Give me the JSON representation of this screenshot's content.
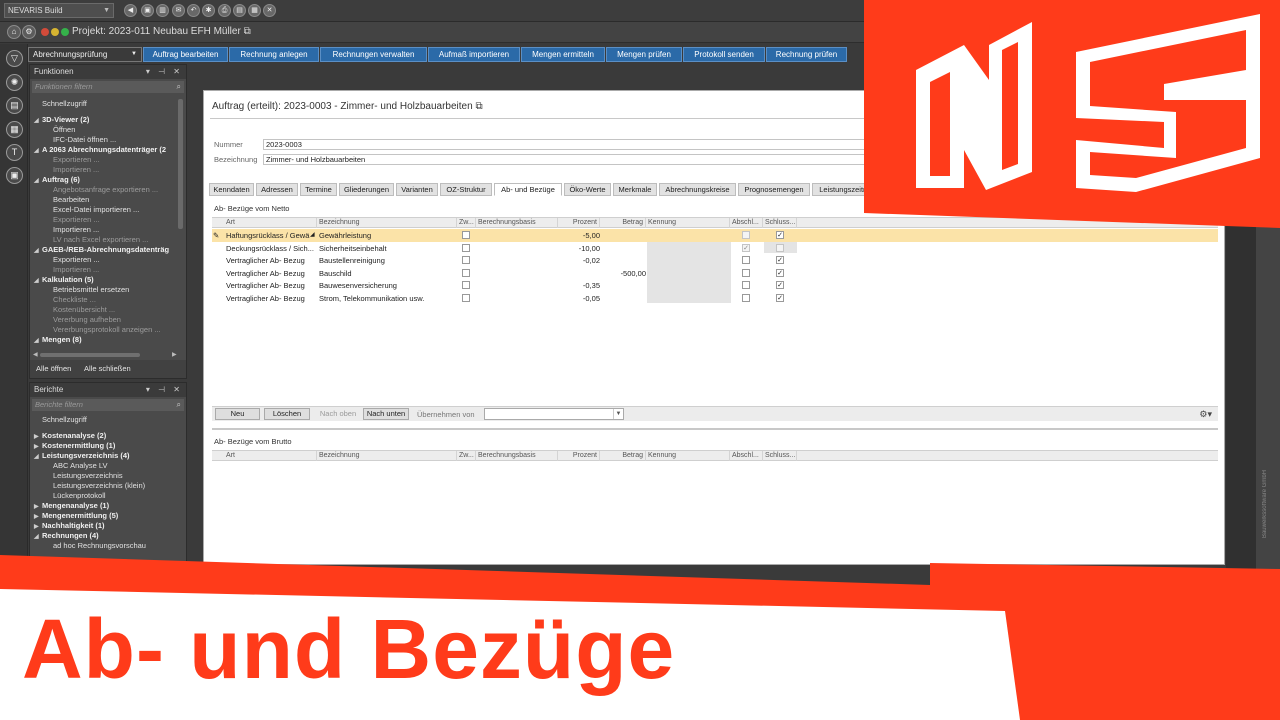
{
  "titlebar": {
    "app_selector": "NEVARIS Build",
    "icons": [
      "back-icon",
      "save-icon",
      "delete-icon",
      "mail-icon",
      "undo-icon",
      "settings-icon",
      "print-icon",
      "close-icon"
    ]
  },
  "projectbar": {
    "title": "Projekt: 2023-011 Neubau EFH Müller ⧉"
  },
  "ribbon": {
    "mode": "Abrechnungsprüfung",
    "tabs": [
      "Auftrag bearbeiten",
      "Rechnung anlegen",
      "Rechnungen verwalten",
      "Aufmaß importieren",
      "Mengen ermitteln",
      "Mengen prüfen",
      "Protokoll senden",
      "Rechnung prüfen"
    ]
  },
  "functions_panel": {
    "title": "Funktionen",
    "controls": "▾ ⊣ ✕",
    "filter_placeholder": "Funktionen filtern",
    "quick_access": "Schnellzugriff",
    "tree": [
      {
        "text": "3D-Viewer (2)",
        "kind": "group"
      },
      {
        "text": "Öffnen",
        "kind": "item"
      },
      {
        "text": "IFC-Datei öffnen ...",
        "kind": "item"
      },
      {
        "text": "A 2063 Abrechnungsdatenträger (2",
        "kind": "group"
      },
      {
        "text": "Exportieren ...",
        "kind": "dim"
      },
      {
        "text": "Importieren ...",
        "kind": "dim"
      },
      {
        "text": "Auftrag (6)",
        "kind": "group"
      },
      {
        "text": "Angebotsanfrage exportieren ...",
        "kind": "dim"
      },
      {
        "text": "Bearbeiten",
        "kind": "item"
      },
      {
        "text": "Excel-Datei importieren ...",
        "kind": "item"
      },
      {
        "text": "Exportieren ...",
        "kind": "dim"
      },
      {
        "text": "Importieren ...",
        "kind": "item"
      },
      {
        "text": "LV nach Excel exportieren ...",
        "kind": "dim"
      },
      {
        "text": "GAEB-/REB-Abrechnungsdatenträg",
        "kind": "group"
      },
      {
        "text": "Exportieren ...",
        "kind": "item"
      },
      {
        "text": "Importieren ...",
        "kind": "dim"
      },
      {
        "text": "Kalkulation (5)",
        "kind": "group"
      },
      {
        "text": "Betriebsmittel ersetzen",
        "kind": "item"
      },
      {
        "text": "Checkliste ...",
        "kind": "dim"
      },
      {
        "text": "Kostenübersicht ...",
        "kind": "dim"
      },
      {
        "text": "Vererbung aufheben",
        "kind": "dim"
      },
      {
        "text": "Vererbungsprotokoll anzeigen ...",
        "kind": "dim"
      },
      {
        "text": "Mengen (8)",
        "kind": "group"
      }
    ],
    "open_all": "Alle öffnen",
    "close_all": "Alle schließen"
  },
  "reports_panel": {
    "title": "Berichte",
    "controls": "▾ ⊣ ✕",
    "filter_placeholder": "Berichte filtern",
    "quick_access": "Schnellzugriff",
    "tree": [
      {
        "text": "Kostenanalyse (2)",
        "kind": "group",
        "open": false
      },
      {
        "text": "Kostenermittlung (1)",
        "kind": "group",
        "open": false
      },
      {
        "text": "Leistungsverzeichnis (4)",
        "kind": "group",
        "open": true
      },
      {
        "text": "ABC Analyse LV",
        "kind": "item"
      },
      {
        "text": "Leistungsverzeichnis",
        "kind": "item"
      },
      {
        "text": "Leistungsverzeichnis (klein)",
        "kind": "item"
      },
      {
        "text": "Lückenprotokoll",
        "kind": "item"
      },
      {
        "text": "Mengenanalyse (1)",
        "kind": "group",
        "open": false
      },
      {
        "text": "Mengenermittlung (5)",
        "kind": "group",
        "open": false
      },
      {
        "text": "Nachhaltigkeit (1)",
        "kind": "group",
        "open": false
      },
      {
        "text": "Rechnungen (4)",
        "kind": "group",
        "open": true
      },
      {
        "text": "ad hoc Rechnungsvorschau",
        "kind": "item"
      }
    ]
  },
  "document": {
    "title": "Auftrag (erteilt): 2023-0003 - Zimmer- und Holzbauarbeiten ⧉",
    "number_label": "Nummer",
    "number_value": "2023-0003",
    "designation_label": "Bezeichnung",
    "designation_value": "Zimmer- und Holzbauarbeiten",
    "tabs": [
      "Kenndaten",
      "Adressen",
      "Termine",
      "Gliederungen",
      "Varianten",
      "OZ-Struktur",
      "Ab- und Bezüge",
      "Öko-Werte",
      "Merkmale",
      "Abrechnungskreise",
      "Prognosemengen",
      "Leistungszeiträ"
    ],
    "active_tab": 6
  },
  "netto_grid": {
    "title": "Ab- Bezüge vom Netto",
    "columns": [
      "Art",
      "Bezeichnung",
      "Zw...",
      "Berechnungsbasis",
      "Prozent",
      "Betrag",
      "Kennung",
      "Abschl...",
      "Schluss..."
    ],
    "rows": [
      {
        "art": "Haftungsrücklass / Gewä",
        "bezeichnung": "Gewährleistung",
        "prozent": "-5,00",
        "betrag": "",
        "abschl": false,
        "schluss": true,
        "abschl_disabled": true,
        "selected": true
      },
      {
        "art": "Deckungsrücklass / Sich...",
        "bezeichnung": "Sicherheitseinbehalt",
        "prozent": "-10,00",
        "betrag": "",
        "abschl": true,
        "schluss": false,
        "abschl_disabled": true,
        "selected": false
      },
      {
        "art": "Vertraglicher Ab- Bezug",
        "bezeichnung": "Baustellenreinigung",
        "prozent": "-0,02",
        "betrag": "",
        "abschl": false,
        "schluss": true,
        "abschl_disabled": false,
        "selected": false
      },
      {
        "art": "Vertraglicher Ab- Bezug",
        "bezeichnung": "Bauschild",
        "prozent": "",
        "betrag": "-500,00",
        "abschl": false,
        "schluss": true,
        "abschl_disabled": false,
        "selected": false
      },
      {
        "art": "Vertraglicher Ab- Bezug",
        "bezeichnung": "Bauwesenversicherung",
        "prozent": "-0,35",
        "betrag": "",
        "abschl": false,
        "schluss": true,
        "abschl_disabled": false,
        "selected": false
      },
      {
        "art": "Vertraglicher Ab- Bezug",
        "bezeichnung": "Strom, Telekommunikation usw.",
        "prozent": "-0,05",
        "betrag": "",
        "abschl": false,
        "schluss": true,
        "abschl_disabled": false,
        "selected": false
      }
    ],
    "buttons": {
      "new": "Neu",
      "delete": "Löschen",
      "up": "Nach oben",
      "down": "Nach unten",
      "take_from": "Übernehmen von"
    }
  },
  "brutto_grid": {
    "title": "Ab- Bezüge vom Brutto",
    "columns": [
      "Art",
      "Bezeichnung",
      "Zw...",
      "Berechnungsbasis",
      "Prozent",
      "Betrag",
      "Kennung",
      "Abschl...",
      "Schluss..."
    ]
  },
  "watermark": "Bauwerkssoftware GmbH",
  "banner": {
    "title": "Ab- und Bezüge",
    "color": "#ff3b1a"
  }
}
